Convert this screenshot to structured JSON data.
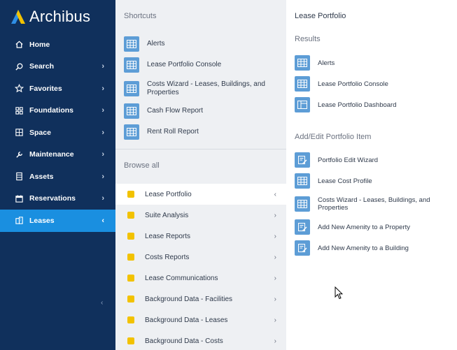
{
  "brand": {
    "name": "Archibus"
  },
  "sidebar": {
    "items": [
      {
        "label": "Home",
        "icon": "home-icon",
        "has_chevron": false
      },
      {
        "label": "Search",
        "icon": "search-icon",
        "has_chevron": true
      },
      {
        "label": "Favorites",
        "icon": "star-icon",
        "has_chevron": true
      },
      {
        "label": "Foundations",
        "icon": "grid-icon",
        "has_chevron": true
      },
      {
        "label": "Space",
        "icon": "floorplan-icon",
        "has_chevron": true
      },
      {
        "label": "Maintenance",
        "icon": "wrench-icon",
        "has_chevron": true
      },
      {
        "label": "Assets",
        "icon": "cabinet-icon",
        "has_chevron": true
      },
      {
        "label": "Reservations",
        "icon": "calendar-icon",
        "has_chevron": true
      },
      {
        "label": "Leases",
        "icon": "building-icon",
        "has_chevron": true,
        "active": true
      }
    ],
    "collapse_glyph": "‹"
  },
  "shortcuts": {
    "title": "Shortcuts",
    "items": [
      {
        "label": "Alerts"
      },
      {
        "label": "Lease Portfolio Console"
      },
      {
        "label": "Costs Wizard - Leases, Buildings, and Properties"
      },
      {
        "label": "Cash Flow Report"
      },
      {
        "label": "Rent Roll Report"
      }
    ]
  },
  "browse": {
    "title": "Browse all",
    "items": [
      {
        "label": "Lease Portfolio",
        "active": true
      },
      {
        "label": "Suite Analysis"
      },
      {
        "label": "Lease Reports"
      },
      {
        "label": "Costs Reports"
      },
      {
        "label": "Lease Communications"
      },
      {
        "label": "Background Data - Facilities"
      },
      {
        "label": "Background Data - Leases"
      },
      {
        "label": "Background Data - Costs"
      }
    ]
  },
  "detail": {
    "title": "Lease Portfolio",
    "results_title": "Results",
    "results": [
      {
        "label": "Alerts",
        "icon": "table-icon"
      },
      {
        "label": "Lease Portfolio Console",
        "icon": "table-icon"
      },
      {
        "label": "Lease Portfolio Dashboard",
        "icon": "dashboard-icon"
      }
    ],
    "edit_title": "Add/Edit Portfolio Item",
    "edit_items": [
      {
        "label": "Portfolio Edit Wizard",
        "icon": "edit-form-icon"
      },
      {
        "label": "Lease Cost Profile",
        "icon": "table-icon"
      },
      {
        "label": "Costs Wizard - Leases, Buildings, and Properties",
        "icon": "table-icon"
      },
      {
        "label": "Add New Amenity to a Property",
        "icon": "edit-form-icon"
      },
      {
        "label": "Add New Amenity to a Building",
        "icon": "edit-form-icon"
      }
    ]
  },
  "colors": {
    "sidebar_bg": "#10305c",
    "active_blue": "#1a8fe0",
    "tile_blue": "#5d9dd6",
    "folder_yellow": "#f2c200",
    "middle_bg": "#eef0f3"
  }
}
